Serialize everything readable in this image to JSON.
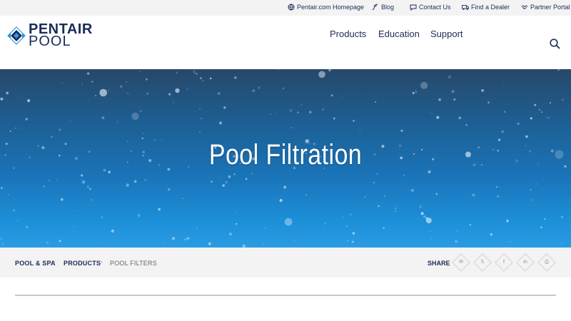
{
  "utility": {
    "items": [
      {
        "label": "Pentair.com Homepage",
        "icon": "globe-icon"
      },
      {
        "label": "Blog",
        "icon": "blog-icon"
      },
      {
        "label": "Contact Us",
        "icon": "chat-icon"
      },
      {
        "label": "Find a Dealer",
        "icon": "truck-icon"
      },
      {
        "label": "Partner Portal",
        "icon": "handshake-icon"
      }
    ]
  },
  "header": {
    "logo_line1": "PENTAIR",
    "logo_line2": "POOL",
    "nav": [
      "Products",
      "Education",
      "Support"
    ]
  },
  "hero": {
    "title": "Pool Filtration"
  },
  "breadcrumb": {
    "items": [
      "POOL & SPA",
      "PRODUCTS",
      "POOL FILTERS"
    ]
  },
  "share": {
    "label": "SHARE",
    "buttons": [
      {
        "icon": "email-icon",
        "glyph": "✉"
      },
      {
        "icon": "x-icon",
        "glyph": "𝕏"
      },
      {
        "icon": "facebook-icon",
        "glyph": "f"
      },
      {
        "icon": "linkedin-icon",
        "glyph": "in"
      },
      {
        "icon": "print-icon",
        "glyph": "⎙"
      }
    ]
  },
  "colors": {
    "brand_navy": "#1a2c57",
    "brand_blue": "#1d8fd9",
    "bar_gray": "#f3f3f3"
  }
}
